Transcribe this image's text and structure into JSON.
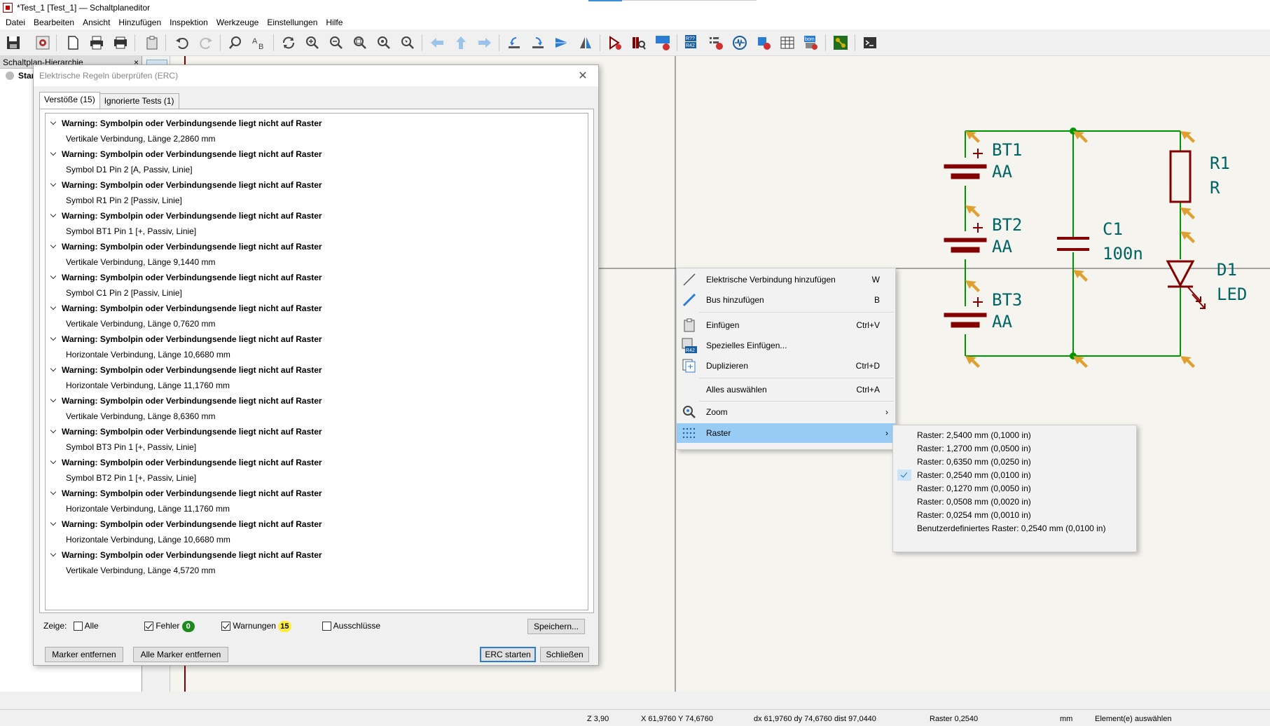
{
  "window": {
    "title": "*Test_1 [Test_1] — Schaltplaneditor"
  },
  "menu": [
    "Datei",
    "Bearbeiten",
    "Ansicht",
    "Hinzufügen",
    "Inspektion",
    "Werkzeuge",
    "Einstellungen",
    "Hilfe"
  ],
  "toolbar": {
    "icons": [
      "save-icon",
      "schematic-setup-icon",
      "page-settings-icon",
      "print-icon",
      "plot-icon",
      "paste-icon",
      "undo-icon",
      "redo-icon",
      "find-icon",
      "find-replace-icon",
      "refresh-icon",
      "zoom-in-icon",
      "zoom-out-icon",
      "zoom-fit-icon",
      "zoom-objects-icon",
      "zoom-selection-icon",
      "arrow-left-icon",
      "arrow-up-icon",
      "arrow-right-icon",
      "rotate-ccw-icon",
      "rotate-cw-icon",
      "mirror-horizontal-icon",
      "mirror-vertical-icon",
      "symbol-editor-icon",
      "symbol-browser-icon",
      "annotate-icon",
      "erc-icon",
      "simulator-icon",
      "assign-footprints-icon",
      "fields-editor-icon",
      "bom-icon",
      "pcb-editor-icon",
      "scripting-console-icon"
    ],
    "annotate_badge": "R??",
    "annotate_badge2": "R42",
    "bom_badge": "bom"
  },
  "hierarchy": {
    "header": "Schaltplan-Hierarchie",
    "close": "×",
    "root": "Star"
  },
  "erc": {
    "title": "Elektrische Regeln überprüfen (ERC)",
    "close": "✕",
    "tabs": [
      "Verstöße (15)",
      "Ignorierte Tests (1)"
    ],
    "items": [
      {
        "warning": "Warning: Symbolpin oder Verbindungsende liegt nicht auf Raster",
        "detail": "Vertikale Verbindung, Länge 2,2860 mm"
      },
      {
        "warning": "Warning: Symbolpin oder Verbindungsende liegt nicht auf Raster",
        "detail": "Symbol D1 Pin 2 [A, Passiv, Linie]"
      },
      {
        "warning": "Warning: Symbolpin oder Verbindungsende liegt nicht auf Raster",
        "detail": "Symbol R1 Pin 2 [Passiv, Linie]"
      },
      {
        "warning": "Warning: Symbolpin oder Verbindungsende liegt nicht auf Raster",
        "detail": "Symbol BT1 Pin 1 [+, Passiv, Linie]"
      },
      {
        "warning": "Warning: Symbolpin oder Verbindungsende liegt nicht auf Raster",
        "detail": "Vertikale Verbindung, Länge 9,1440 mm"
      },
      {
        "warning": "Warning: Symbolpin oder Verbindungsende liegt nicht auf Raster",
        "detail": "Symbol C1 Pin 2 [Passiv, Linie]"
      },
      {
        "warning": "Warning: Symbolpin oder Verbindungsende liegt nicht auf Raster",
        "detail": "Vertikale Verbindung, Länge 0,7620 mm"
      },
      {
        "warning": "Warning: Symbolpin oder Verbindungsende liegt nicht auf Raster",
        "detail": "Horizontale Verbindung, Länge 10,6680 mm"
      },
      {
        "warning": "Warning: Symbolpin oder Verbindungsende liegt nicht auf Raster",
        "detail": "Horizontale Verbindung, Länge 11,1760 mm"
      },
      {
        "warning": "Warning: Symbolpin oder Verbindungsende liegt nicht auf Raster",
        "detail": "Vertikale Verbindung, Länge 8,6360 mm"
      },
      {
        "warning": "Warning: Symbolpin oder Verbindungsende liegt nicht auf Raster",
        "detail": "Symbol BT3 Pin 1 [+, Passiv, Linie]"
      },
      {
        "warning": "Warning: Symbolpin oder Verbindungsende liegt nicht auf Raster",
        "detail": "Symbol BT2 Pin 1 [+, Passiv, Linie]"
      },
      {
        "warning": "Warning: Symbolpin oder Verbindungsende liegt nicht auf Raster",
        "detail": "Horizontale Verbindung, Länge 11,1760 mm"
      },
      {
        "warning": "Warning: Symbolpin oder Verbindungsende liegt nicht auf Raster",
        "detail": "Horizontale Verbindung, Länge 10,6680 mm"
      },
      {
        "warning": "Warning: Symbolpin oder Verbindungsende liegt nicht auf Raster",
        "detail": "Vertikale Verbindung, Länge 4,5720 mm"
      }
    ],
    "filter": {
      "label": "Zeige:",
      "all": {
        "label": "Alle",
        "checked": false
      },
      "errors": {
        "label": "Fehler",
        "checked": true,
        "count": "0"
      },
      "warnings": {
        "label": "Warnungen",
        "checked": true,
        "count": "15"
      },
      "exclusions": {
        "label": "Ausschlüsse",
        "checked": false
      }
    },
    "buttons": {
      "save": "Speichern...",
      "remove_marker": "Marker entfernen",
      "remove_all_markers": "Alle Marker entfernen",
      "run": "ERC starten",
      "close": "Schließen"
    }
  },
  "context_menu": [
    {
      "icon": "wire-icon",
      "label": "Elektrische Verbindung hinzufügen",
      "shortcut": "W"
    },
    {
      "icon": "bus-icon",
      "label": "Bus hinzufügen",
      "shortcut": "B"
    },
    {
      "icon": "paste-icon",
      "label": "Einfügen",
      "shortcut": "Ctrl+V"
    },
    {
      "icon": "paste-special-icon",
      "label": "Spezielles Einfügen...",
      "shortcut": "",
      "badge": "R42"
    },
    {
      "icon": "duplicate-icon",
      "label": "Duplizieren",
      "shortcut": "Ctrl+D"
    },
    {
      "icon": "",
      "label": "Alles auswählen",
      "shortcut": "Ctrl+A"
    },
    {
      "icon": "zoom-icon",
      "label": "Zoom",
      "shortcut": "",
      "arrow": "›"
    },
    {
      "icon": "grid-icon",
      "label": "Raster",
      "shortcut": "",
      "arrow": "›",
      "highlight": true
    }
  ],
  "grid_submenu": [
    {
      "label": "Raster: 2,5400 mm (0,1000 in)",
      "checked": false
    },
    {
      "label": "Raster: 1,2700 mm (0,0500 in)",
      "checked": false
    },
    {
      "label": "Raster: 0,6350 mm (0,0250 in)",
      "checked": false
    },
    {
      "label": "Raster: 0,2540 mm (0,0100 in)",
      "checked": true
    },
    {
      "label": "Raster: 0,1270 mm (0,0050 in)",
      "checked": false
    },
    {
      "label": "Raster: 0,0508 mm (0,0020 in)",
      "checked": false
    },
    {
      "label": "Raster: 0,0254 mm (0,0010 in)",
      "checked": false
    },
    {
      "label": "Benutzerdefiniertes Raster: 0,2540 mm (0,0100 in)",
      "checked": false
    }
  ],
  "schematic": {
    "wire_color": "#009600",
    "symbol_color": "#840000",
    "text_color": "#006464",
    "marker_color": "#e0a030",
    "components": [
      {
        "ref": "BT1",
        "value": "AA"
      },
      {
        "ref": "BT2",
        "value": "AA"
      },
      {
        "ref": "BT3",
        "value": "AA"
      },
      {
        "ref": "C1",
        "value": "100n"
      },
      {
        "ref": "R1",
        "value": "R"
      },
      {
        "ref": "D1",
        "value": "LED"
      }
    ]
  },
  "status": {
    "zoom": "Z 3,90",
    "xy": "X 61,9760  Y 74,6760",
    "delta": "dx 61,9760  dy 74,6760  dist 97,0440",
    "grid": "Raster 0,2540",
    "units": "mm",
    "mode": "Element(e) auswählen"
  }
}
